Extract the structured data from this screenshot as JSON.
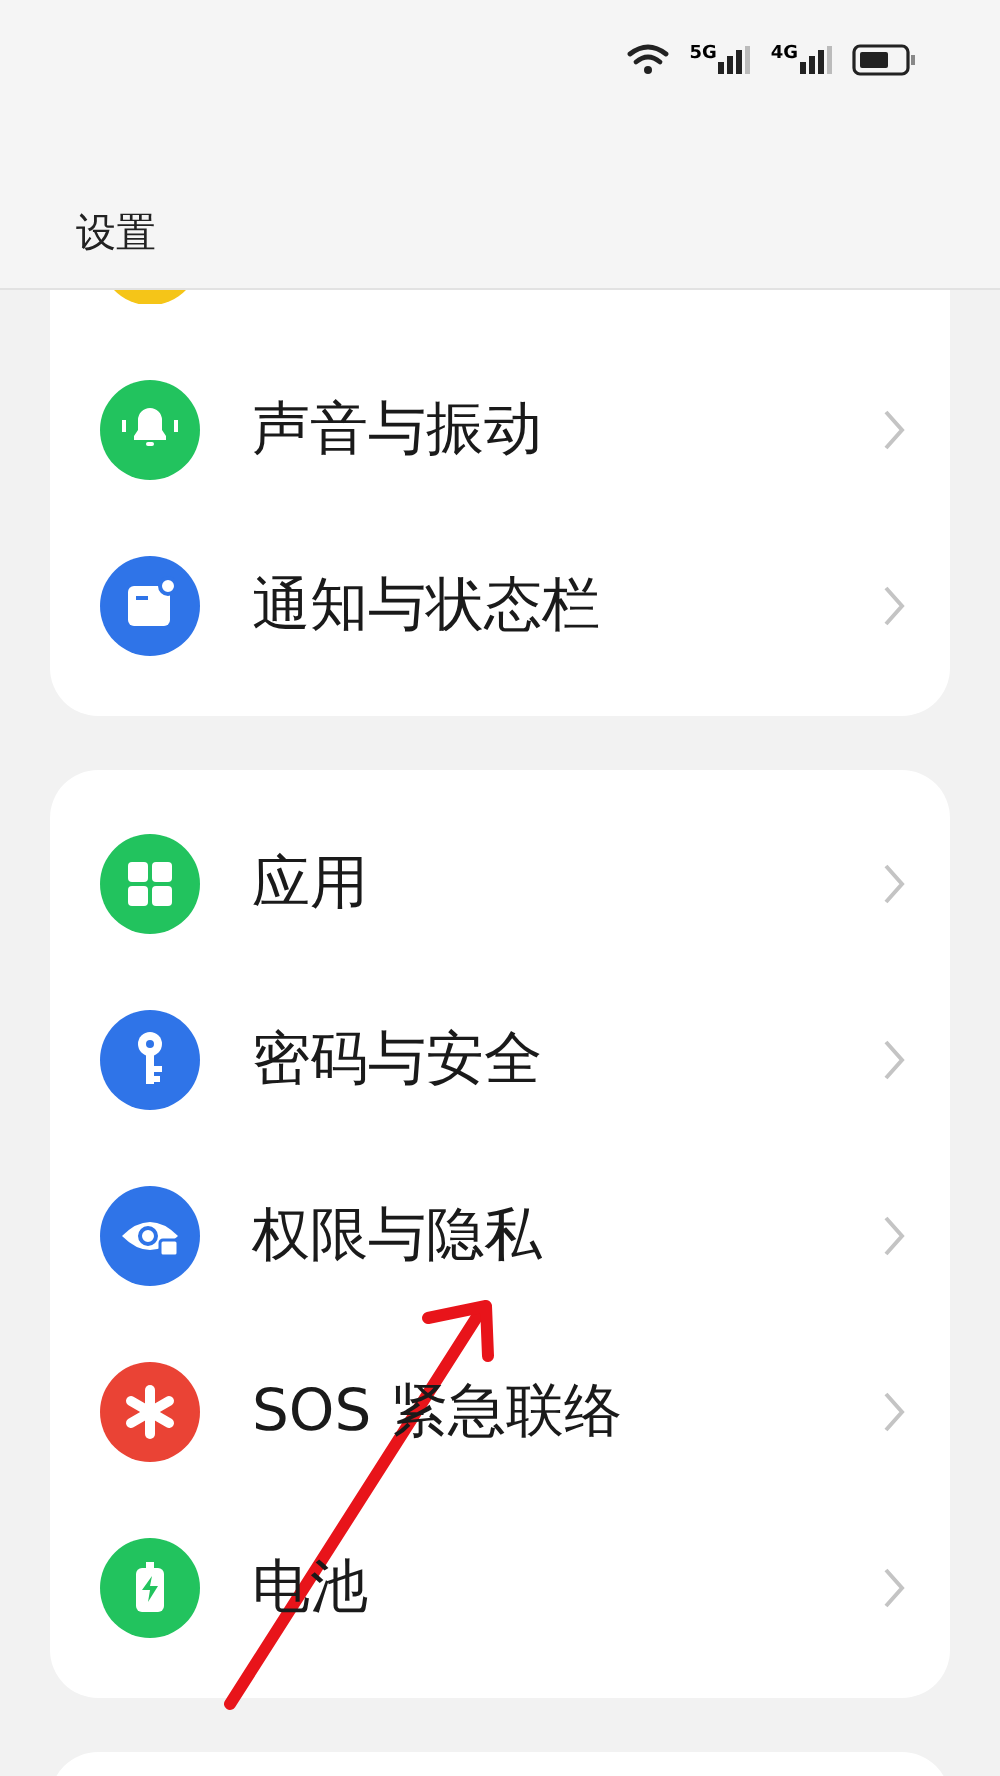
{
  "status_bar": {
    "signals": [
      {
        "label": "5G"
      },
      {
        "label": "4G"
      }
    ]
  },
  "header": {
    "title": "设置"
  },
  "groups": [
    {
      "partial_icon": true,
      "items": [
        {
          "kind": "bell",
          "label": "声音与振动"
        },
        {
          "kind": "notification",
          "label": "通知与状态栏"
        }
      ]
    },
    {
      "partial_icon": false,
      "items": [
        {
          "kind": "apps",
          "label": "应用"
        },
        {
          "kind": "key",
          "label": "密码与安全"
        },
        {
          "kind": "privacy",
          "label": "权限与隐私"
        },
        {
          "kind": "sos",
          "label": "SOS 紧急联络"
        },
        {
          "kind": "battery",
          "label": "电池"
        }
      ]
    }
  ],
  "annotation": {
    "kind": "arrow"
  }
}
